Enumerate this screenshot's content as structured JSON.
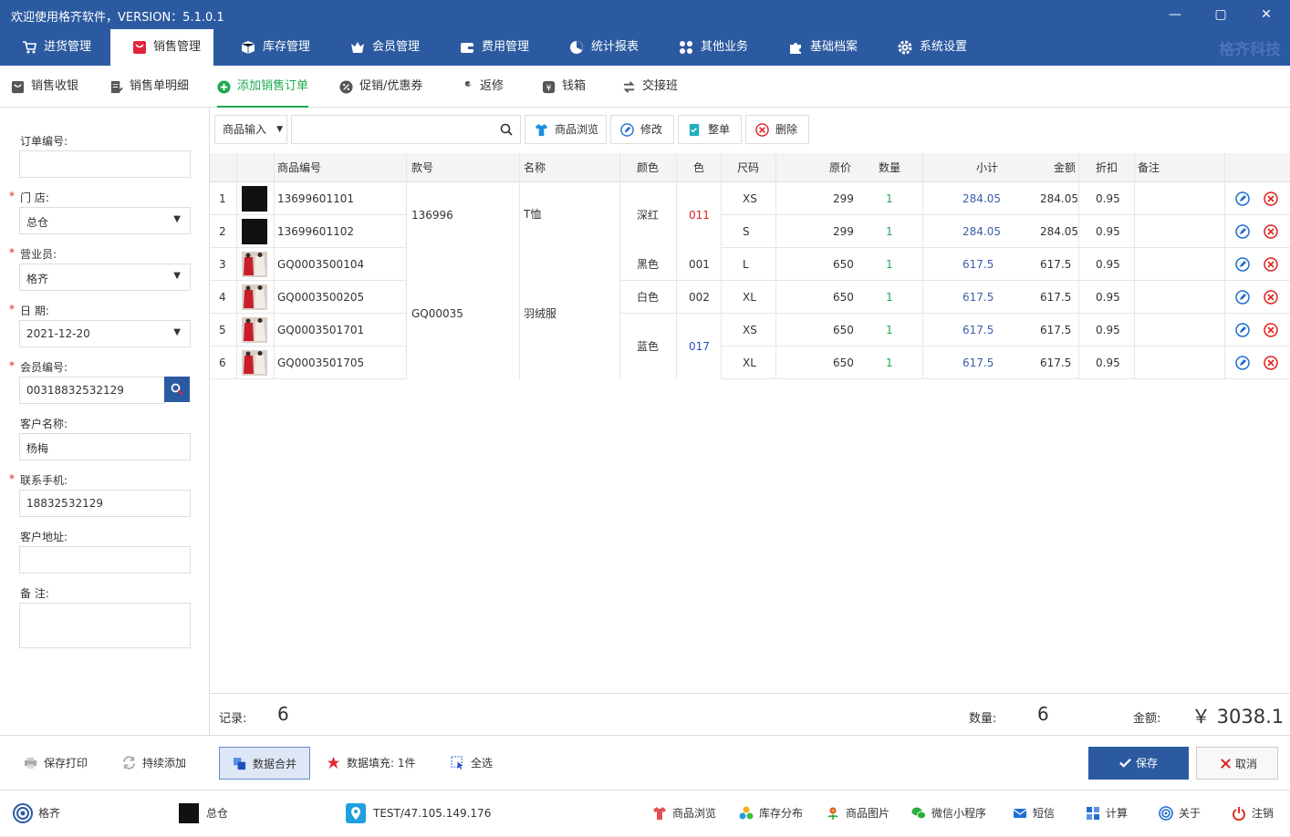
{
  "window": {
    "title": "欢迎使用格齐软件，VERSION：5.1.0.1",
    "min": "—",
    "max": "▢",
    "close": "✕"
  },
  "nav": {
    "items": [
      {
        "label": "进货管理"
      },
      {
        "label": "销售管理"
      },
      {
        "label": "库存管理"
      },
      {
        "label": "会员管理"
      },
      {
        "label": "费用管理"
      },
      {
        "label": "统计报表"
      },
      {
        "label": "其他业务"
      },
      {
        "label": "基础档案"
      },
      {
        "label": "系统设置"
      }
    ],
    "brand": "格齐科技"
  },
  "subnav": {
    "items": [
      {
        "label": "销售收银"
      },
      {
        "label": "销售单明细"
      },
      {
        "label": "添加销售订单"
      },
      {
        "label": "促销/优惠券"
      },
      {
        "label": "返修"
      },
      {
        "label": "钱箱"
      },
      {
        "label": "交接班"
      }
    ]
  },
  "form": {
    "order_no_label": "订单编号:",
    "order_no": "",
    "store_label": "门  店:",
    "store": "总仓",
    "clerk_label": "营业员:",
    "clerk": "格齐",
    "date_label": "日  期:",
    "date": "2021-12-20",
    "member_label": "会员编号:",
    "member": "00318832532129",
    "customer_label": "客户名称:",
    "customer": "杨梅",
    "phone_label": "联系手机:",
    "phone": "18832532129",
    "address_label": "客户地址:",
    "address": "",
    "note_label": "备  注:",
    "note": ""
  },
  "toolbar": {
    "input_mode": "商品输入",
    "search_value": "",
    "browse": "商品浏览",
    "edit": "修改",
    "whole": "整单",
    "delete": "删除"
  },
  "table": {
    "headers": [
      "商品编号",
      "款号",
      "名称",
      "颜色",
      "色",
      "尺码",
      "原价",
      "数量",
      "小计",
      "金额",
      "折扣",
      "备注"
    ],
    "rows": [
      {
        "idx": "1",
        "code": "13699601101",
        "size": "XS",
        "price": "299",
        "qty": "1",
        "subtotal": "284.05",
        "amount": "284.05",
        "discount": "0.95"
      },
      {
        "idx": "2",
        "code": "13699601102",
        "size": "S",
        "price": "299",
        "qty": "1",
        "subtotal": "284.05",
        "amount": "284.05",
        "discount": "0.95"
      },
      {
        "idx": "3",
        "code": "GQ0003500104",
        "size": "L",
        "price": "650",
        "qty": "1",
        "subtotal": "617.5",
        "amount": "617.5",
        "discount": "0.95"
      },
      {
        "idx": "4",
        "code": "GQ0003500205",
        "size": "XL",
        "price": "650",
        "qty": "1",
        "subtotal": "617.5",
        "amount": "617.5",
        "discount": "0.95"
      },
      {
        "idx": "5",
        "code": "GQ0003501701",
        "size": "XS",
        "price": "650",
        "qty": "1",
        "subtotal": "617.5",
        "amount": "617.5",
        "discount": "0.95"
      },
      {
        "idx": "6",
        "code": "GQ0003501705",
        "size": "XL",
        "price": "650",
        "qty": "1",
        "subtotal": "617.5",
        "amount": "617.5",
        "discount": "0.95"
      }
    ],
    "merged": {
      "style_a": "136996",
      "name_a": "T恤",
      "color_a": "深红",
      "cc_a": "011",
      "style_b": "GQ00035",
      "name_b": "羽绒服",
      "color_b": "黑色",
      "cc_b": "001",
      "color_c": "白色",
      "cc_c": "002",
      "color_d": "蓝色",
      "cc_d": "017"
    }
  },
  "summary": {
    "records_label": "记录:",
    "records": "6",
    "qty_label": "数量:",
    "qty": "6",
    "amount_label": "金额:",
    "amount": "￥ 3038.1"
  },
  "actions": {
    "save_print": "保存打印",
    "continuous": "持续添加",
    "merge": "数据合并",
    "fill": "数据填充:",
    "fill_count": "1件",
    "select_all": "全选",
    "save": "保存",
    "cancel": "取消"
  },
  "status": {
    "user": "格齐",
    "store": "总仓",
    "server": "TEST/47.105.149.176",
    "links": [
      {
        "label": "商品浏览"
      },
      {
        "label": "库存分布"
      },
      {
        "label": "商品图片"
      },
      {
        "label": "微信小程序"
      },
      {
        "label": "短信"
      },
      {
        "label": "计算"
      },
      {
        "label": "关于"
      },
      {
        "label": "注销"
      }
    ]
  },
  "colors": {
    "primary": "#2c5aa0",
    "active_green": "#1ea850",
    "link_blue": "#3a5faa",
    "qty_green": "#1ea850",
    "code_red": "#e02020",
    "code_blue": "#2a4ec0"
  }
}
